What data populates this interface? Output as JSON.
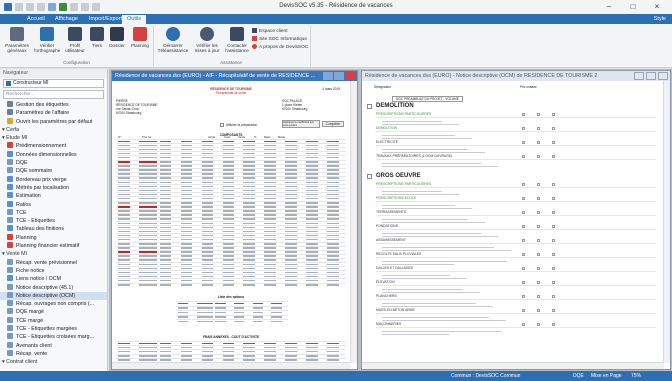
{
  "window": {
    "title": "DevisSOC v5.35 - Résidence de vacances",
    "style_label": "Style"
  },
  "ribbon_tabs": [
    {
      "label": "Accueil"
    },
    {
      "label": "Affichage"
    },
    {
      "label": "Import/Export"
    },
    {
      "label": "Outils"
    }
  ],
  "ribbon": {
    "buttons": [
      {
        "label": "Paramètres\ngénéraux",
        "icon": "gears-icon"
      },
      {
        "label": "Vérifier\nl'orthographe",
        "icon": "spellcheck-icon"
      },
      {
        "label": "Profil\nutilisateur",
        "icon": "profile-icon"
      },
      {
        "label": "Tiers",
        "icon": "people-icon"
      },
      {
        "label": "Dossier",
        "icon": "folder-icon"
      },
      {
        "label": "Planning",
        "icon": "calendar-icon"
      },
      {
        "label": "Démarrer\nTéléassistance",
        "icon": "teleassist-icon"
      },
      {
        "label": "Vérifier les\nmises à jour",
        "icon": "update-icon"
      },
      {
        "label": "Contacter\nl'assistance",
        "icon": "phone-icon"
      }
    ],
    "small_commands": [
      {
        "label": "Espace client",
        "icon": "home-icon"
      },
      {
        "label": "Site SOC Informatique",
        "icon": "site-icon"
      },
      {
        "label": "A propos de DevisSOC",
        "icon": "info-icon"
      }
    ],
    "groups": [
      "Configuration",
      "Assistance"
    ]
  },
  "navigator": {
    "header": "Navigateur",
    "combo": "Constructeur MI",
    "search_placeholder": "Rechercher...",
    "items": [
      {
        "label": "Gestion des étiquettes",
        "level": 1,
        "icon": "tags-icon",
        "color": "#6a7fa0"
      },
      {
        "label": "Paramètres de l'affaire",
        "level": 1,
        "icon": "settings-icon",
        "color": "#6a7fa0"
      },
      {
        "label": "Ouvrir les paramètres par défaut",
        "level": 1,
        "icon": "folder-icon",
        "color": "#e0a52e"
      },
      {
        "label": "Cerfa",
        "level": 0,
        "icon": "",
        "color": ""
      },
      {
        "label": "Etude MI",
        "level": 0,
        "icon": "",
        "color": ""
      },
      {
        "label": "Prédimensionnement",
        "level": 1,
        "icon": "gauge-icon",
        "color": "#d64040"
      },
      {
        "label": "Données dimensionnelles",
        "level": 1,
        "icon": "grid-icon",
        "color": "#5a8fd0"
      },
      {
        "label": "DQE",
        "level": 1,
        "icon": "doc-icon",
        "color": "#7a99c2"
      },
      {
        "label": "DQE sommaire",
        "level": 1,
        "icon": "doc-icon",
        "color": "#7a99c2"
      },
      {
        "label": "Bordereau prix vierge",
        "level": 1,
        "icon": "doc-icon",
        "color": "#5a8fd0"
      },
      {
        "label": "Métrés par localisation",
        "level": 1,
        "icon": "doc-icon",
        "color": "#5a8fd0"
      },
      {
        "label": "Estimation",
        "level": 1,
        "icon": "grid-icon",
        "color": "#5a8fd0"
      },
      {
        "label": "Ratios",
        "level": 1,
        "icon": "grid-icon",
        "color": "#5a8fd0"
      },
      {
        "label": "TCE",
        "level": 1,
        "icon": "doc-icon",
        "color": "#7a99c2"
      },
      {
        "label": "TCE - Etiquettes",
        "level": 1,
        "icon": "doc-icon",
        "color": "#7a99c2"
      },
      {
        "label": "Tableau des finitions",
        "level": 1,
        "icon": "grid-icon",
        "color": "#5a8fd0"
      },
      {
        "label": "Planning",
        "level": 1,
        "icon": "calendar-icon",
        "color": "#d64040"
      },
      {
        "label": "Planning financier estimatif",
        "level": 1,
        "icon": "calendar-icon",
        "color": "#d64040"
      },
      {
        "label": "Vente MI",
        "level": 0,
        "icon": "",
        "color": ""
      },
      {
        "label": "Récap. vente prévisionnel",
        "level": 1,
        "icon": "doc-icon",
        "color": "#7a99c2"
      },
      {
        "label": "Fiche notice",
        "level": 1,
        "icon": "doc-icon",
        "color": "#7a99c2"
      },
      {
        "label": "Liens notice / OCM",
        "level": 1,
        "icon": "link-icon",
        "color": "#5a8fd0"
      },
      {
        "label": "Notice descriptive (45.1)",
        "level": 1,
        "icon": "doc-icon",
        "color": "#7a99c2"
      },
      {
        "label": "Notice descriptive (OCM)",
        "level": 1,
        "icon": "doc-icon",
        "color": "#7a99c2",
        "selected": true
      },
      {
        "label": "Récap. ouvrages non compris (...",
        "level": 1,
        "icon": "doc-icon",
        "color": "#7a99c2"
      },
      {
        "label": "DQE margé",
        "level": 1,
        "icon": "doc-icon",
        "color": "#7a99c2"
      },
      {
        "label": "TCE margé",
        "level": 1,
        "icon": "doc-icon",
        "color": "#7a99c2"
      },
      {
        "label": "TCE - Etiquettes margées",
        "level": 1,
        "icon": "doc-icon",
        "color": "#7a99c2"
      },
      {
        "label": "TCE - Etiquettes croisées marg...",
        "level": 1,
        "icon": "doc-icon",
        "color": "#7a99c2"
      },
      {
        "label": "Avenants client",
        "level": 1,
        "icon": "doc-icon",
        "color": "#7a99c2"
      },
      {
        "label": "Récap. vente",
        "level": 1,
        "icon": "doc-icon",
        "color": "#7a99c2"
      },
      {
        "label": "Contrat client",
        "level": 0,
        "icon": "",
        "color": ""
      }
    ]
  },
  "doc1": {
    "title": "Résidence de vacances.dvs (EURO) - AIF - Récapitulatif de vente de RESIDENCE ...",
    "heading": "RÉSIDENCE DE TOURISME",
    "subheading": "Récapitulatif de vente",
    "date": "4 mars 2019",
    "left_block": [
      "PIERRE",
      "RÉSIDENCE DE TOURISME",
      "rue Sainte-Croix",
      "67000 Strasbourg"
    ],
    "right_block": [
      "SOC PALACE",
      "1 place Kléber",
      "67000 Strasbourg"
    ],
    "checkbox_label": "Afficher la préparation",
    "btn1": "Appliquer le coefficient aux sous-postes",
    "btn2": "Compléter",
    "section1": "COMPOSANTS",
    "columns": [
      "N°",
      "Titre lot",
      "Achat",
      "Coef",
      "Vente",
      "%",
      "Ratio",
      "Mode"
    ],
    "section2": "Liste des options",
    "section3": "FRAIS ANNEXES - COUT D'ACTIVITE"
  },
  "doc2": {
    "title": "Résidence de vacances.dvs (EURO) - Notice descriptive (OCM) de RESIDENCE DE TOURISME 2",
    "col1": "Désignation",
    "col_header": "Prix unitaire",
    "banner": "DOC PREAMBULE DU PROJET - VOLUME",
    "sections": [
      {
        "title": "DEMOLITION",
        "lines": [
          "PRESCRIPTIONS PARTICULIÈRES",
          "DEMOLITION",
          "ELECTRICITE",
          "TRAVAUX PRÉPARATOIRES (L'OCM OUVRAGE)"
        ]
      },
      {
        "title": "GROS OEUVRE",
        "lines": [
          "PRESCRIPTIONS PARTICULIÈRES",
          "PRESCRIPTIONS ÉCOLE",
          "TERRASSEMENTS",
          "FONDATIONS",
          "ASSAINISSEMENT",
          "RECOLTE EAUX PLUVIALES",
          "DALLES ET DALLAGES",
          "ÉLEVATION",
          "PLANCHERS",
          "MURS EN BÉTON ARMÉ",
          "MAÇONNERIES"
        ]
      }
    ]
  },
  "status_bar": [
    {
      "label": "Commun : DevisSOC Commun"
    },
    {
      "label": "DQE"
    },
    {
      "label": "Mise en Page"
    },
    {
      "label": "75%"
    }
  ],
  "colors": {
    "ribbon_blue": "#2c6fb3",
    "selection": "#cfe0f3",
    "heading_red": "#c62828",
    "section_green": "#3a8c3a"
  }
}
